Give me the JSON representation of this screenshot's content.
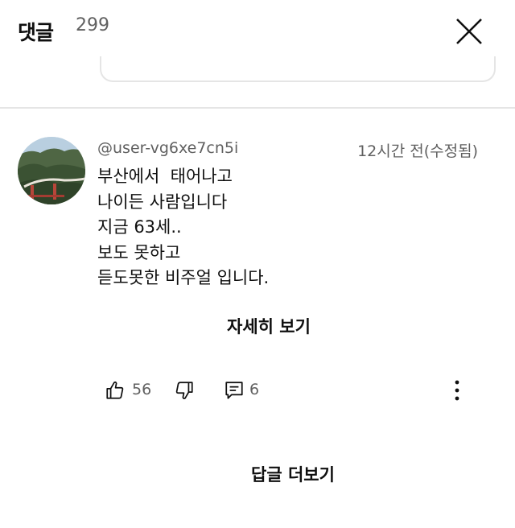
{
  "header": {
    "title": "댓글",
    "count": "299",
    "close_icon": "close-icon"
  },
  "comment": {
    "author": "@user-vg6xe7cn5i",
    "time": "12시간 전(수정됨)",
    "lines": [
      "부산에서  태어나고",
      "나이든 사람입니다",
      "지금 63세..",
      "보도 못하고",
      "듣도못한 비주얼 입니다."
    ],
    "read_more": "자세히 보기",
    "like_count": "56",
    "reply_count": "6",
    "icons": {
      "like": "thumbs-up-icon",
      "dislike": "thumbs-down-icon",
      "reply": "reply-icon",
      "more": "more-vertical-icon"
    }
  },
  "more_replies": "답글 더보기",
  "colors": {
    "text_primary": "#0f0f0f",
    "text_secondary": "#606060",
    "divider": "#e5e5e5"
  }
}
